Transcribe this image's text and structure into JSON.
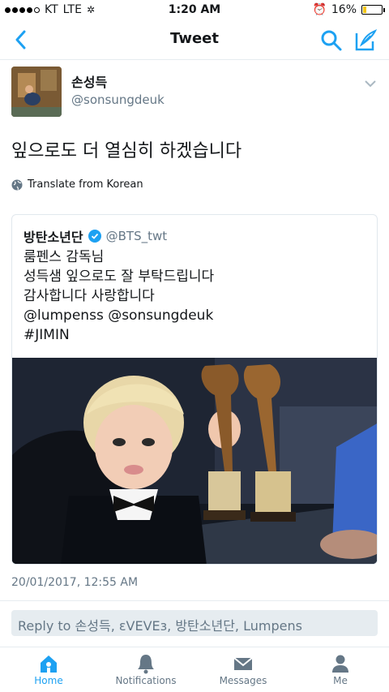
{
  "status": {
    "carrier": "KT",
    "network": "LTE",
    "time": "1:20 AM",
    "battery": "16%",
    "battery_level": 0.16
  },
  "nav": {
    "title": "Tweet"
  },
  "author": {
    "name": "손성득",
    "handle": "@sonsungdeuk"
  },
  "tweet": {
    "text": "잎으로도 더 열심히 하겠습니다",
    "translate": "Translate from Korean"
  },
  "quote": {
    "name": "방탄소년단",
    "handle": "@BTS_twt",
    "lines": [
      "룸펜스 감독님",
      "성득샘 잎으로도 잘 부탁드립니다",
      "감사합니다 사랑합니다",
      "@lumpenss @sonsungdeuk",
      "#JIMIN"
    ]
  },
  "timestamp": "20/01/2017, 12:55 AM",
  "reply": {
    "placeholder": "Reply to 손성득, εVEVEз, 방탄소년단, Lumpens"
  },
  "tabs": [
    {
      "label": "Home",
      "icon": "home-icon"
    },
    {
      "label": "Notifications",
      "icon": "bell-icon"
    },
    {
      "label": "Messages",
      "icon": "envelope-icon"
    },
    {
      "label": "Me",
      "icon": "person-icon"
    }
  ],
  "colors": {
    "accent": "#1da1f2",
    "muted": "#657786",
    "battery": "#f5c518"
  }
}
